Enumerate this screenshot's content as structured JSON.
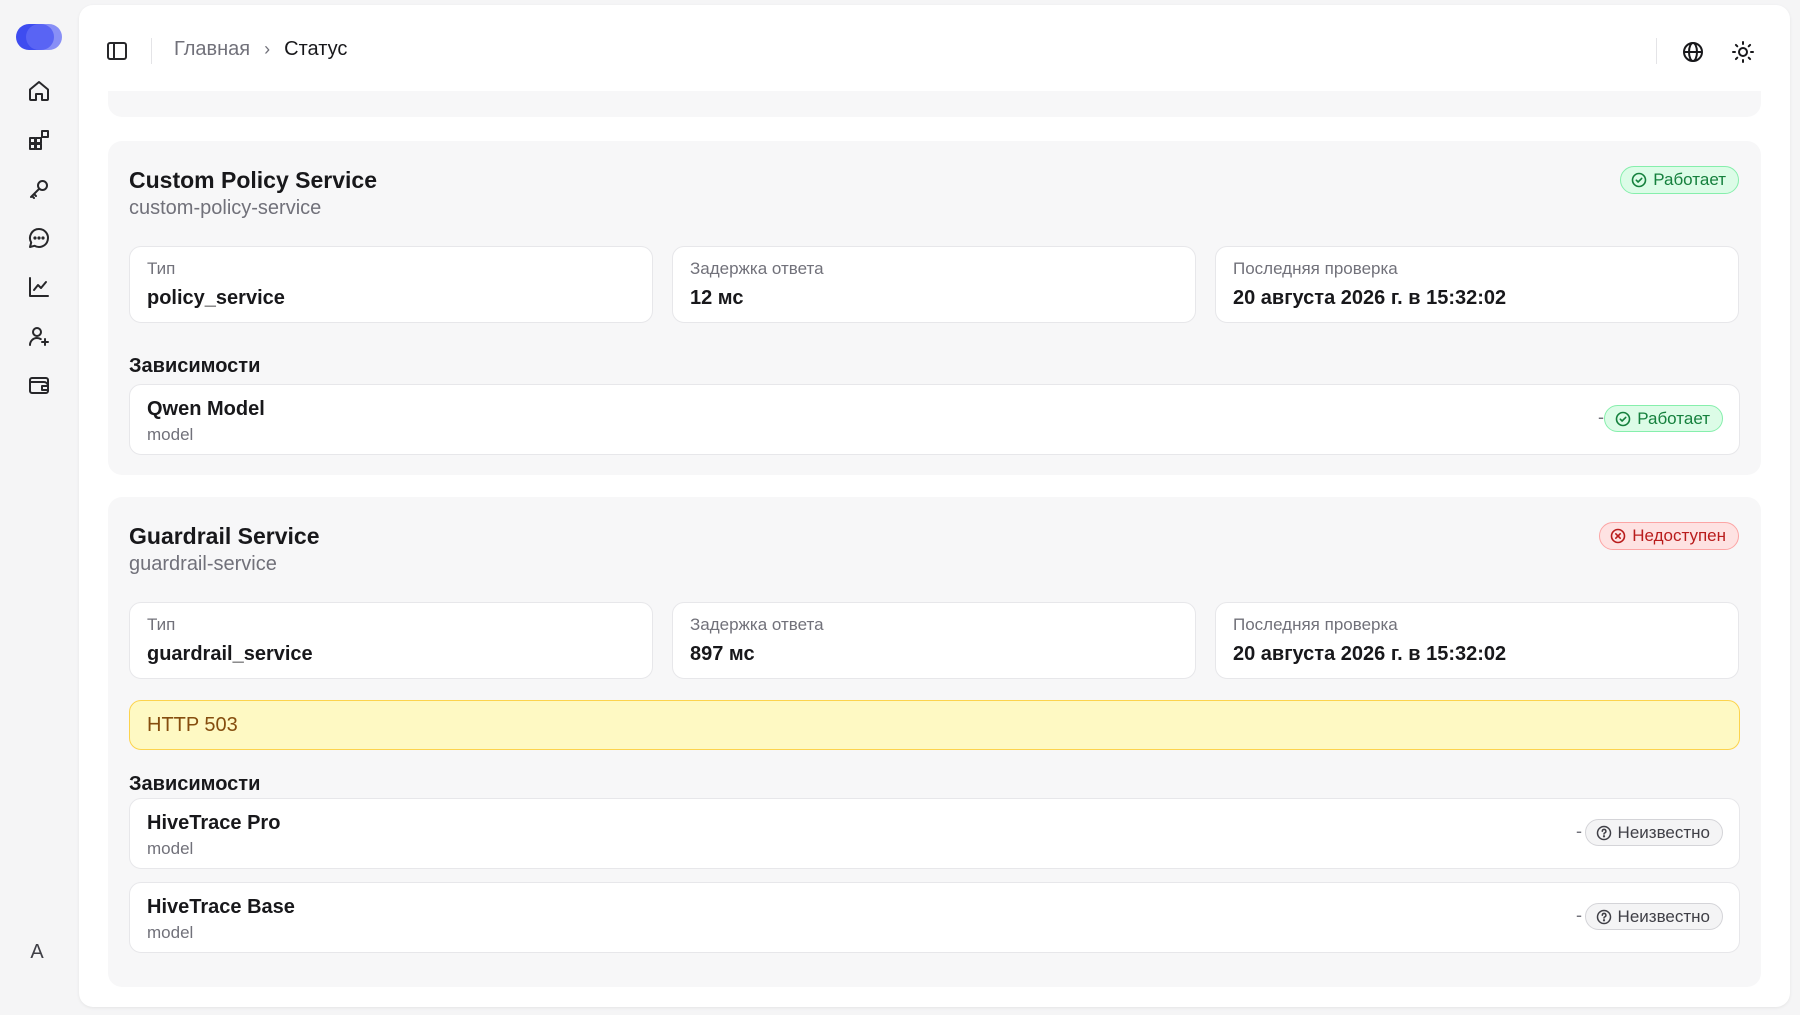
{
  "sidebar": {
    "items": [
      {
        "name": "home-icon",
        "label": "home"
      },
      {
        "name": "widgets-icon",
        "label": "widgets"
      },
      {
        "name": "key-icon",
        "label": "key"
      },
      {
        "name": "chat-icon",
        "label": "chat"
      },
      {
        "name": "chart-icon",
        "label": "chart"
      },
      {
        "name": "user-plus-icon",
        "label": "user-plus"
      },
      {
        "name": "wallet-icon",
        "label": "wallet"
      }
    ],
    "avatar_letter": "A"
  },
  "header": {
    "breadcrumb_home": "Главная",
    "breadcrumb_separator": "›",
    "breadcrumb_current": "Статус"
  },
  "services": [
    {
      "title": "Custom Policy Service",
      "slug": "custom-policy-service",
      "status": "Работает",
      "status_color": "#15803d",
      "stats": [
        {
          "label": "Тип",
          "value": "policy_service"
        },
        {
          "label": "Задержка ответа",
          "value": "12 мс"
        },
        {
          "label": "Последняя проверка",
          "value": "20 августа 2026 г. в 15:32:02"
        }
      ],
      "deps_title": "Зависимости",
      "dependencies": [
        {
          "name": "Qwen Model",
          "kind": "model",
          "latency": "-",
          "status": "Работает"
        }
      ]
    },
    {
      "title": "Guardrail Service",
      "slug": "guardrail-service",
      "status": "Недоступен",
      "status_color": "#b91c1c",
      "stats": [
        {
          "label": "Тип",
          "value": "guardrail_service"
        },
        {
          "label": "Задержка ответа",
          "value": "897 мс"
        },
        {
          "label": "Последняя проверка",
          "value": "20 августа 2026 г. в 15:32:02"
        }
      ],
      "error": "HTTP 503",
      "deps_title": "Зависимости",
      "dependencies": [
        {
          "name": "HiveTrace Pro",
          "kind": "model",
          "latency": "-",
          "status": "Неизвестно"
        },
        {
          "name": "HiveTrace Base",
          "kind": "model",
          "latency": "-",
          "status": "Неизвестно"
        }
      ]
    }
  ]
}
